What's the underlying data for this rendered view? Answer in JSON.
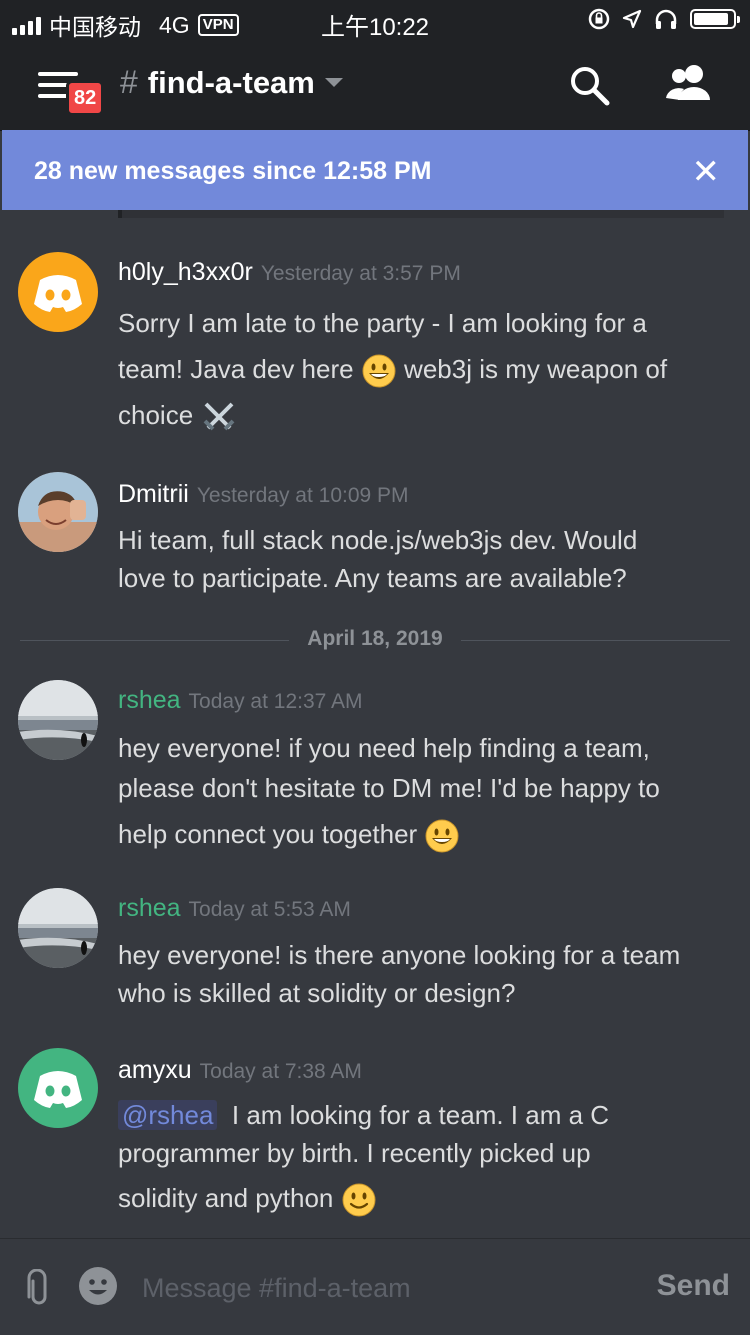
{
  "status_bar": {
    "carrier": "中国移动",
    "network": "4G",
    "vpn": "VPN",
    "time": "上午10:22",
    "battery_level": 0.9
  },
  "header": {
    "channel_name": "find-a-team",
    "notification_count": "82"
  },
  "banner": {
    "text": "28 new messages since 12:58 PM"
  },
  "date_divider": "April 18, 2019",
  "messages": [
    {
      "author": "h0ly_h3xx0r",
      "author_color": "#ffffff",
      "avatar": "discord-logo-avatar-orange",
      "avatar_color": "#faa61a",
      "timestamp": "Yesterday at 3:57 PM",
      "lines": [
        "Sorry I am late to the party - I am looking for a",
        "team! Java dev here",
        "web3j is my weapon of",
        "choice"
      ]
    },
    {
      "author": "Dmitrii",
      "author_color": "#ffffff",
      "avatar": "photo-avatar",
      "timestamp": "Yesterday at 10:09 PM",
      "lines": [
        "Hi team, full stack node.js/web3js dev. Would",
        "love to participate. Any teams are available?"
      ]
    },
    {
      "author": "rshea",
      "author_color": "#43b581",
      "avatar": "beach-photo-avatar",
      "timestamp": "Today at 12:37 AM",
      "lines": [
        "hey everyone! if you need help finding a team,",
        "please don't hesitate to DM me! I'd be happy to",
        "help connect you together"
      ]
    },
    {
      "author": "rshea",
      "author_color": "#43b581",
      "avatar": "beach-photo-avatar",
      "timestamp": "Today at 5:53 AM",
      "lines": [
        "hey everyone! is there anyone looking for a team",
        "who is skilled at solidity or design?"
      ]
    },
    {
      "author": "amyxu",
      "author_color": "#ffffff",
      "avatar": "discord-logo-avatar-green",
      "avatar_color": "#43b581",
      "timestamp": "Today at 7:38 AM",
      "mention": "@rshea",
      "lines": [
        "I am looking for a team. I am a C",
        "programmer by birth. I recently picked up",
        "solidity and python"
      ]
    }
  ],
  "composer": {
    "placeholder": "Message #find-a-team",
    "send_label": "Send"
  }
}
